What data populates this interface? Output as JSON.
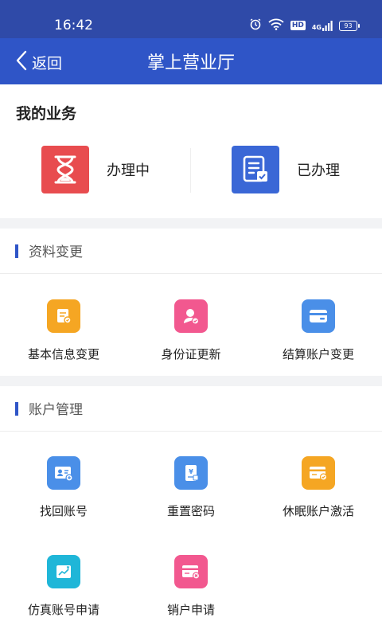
{
  "status_bar": {
    "time": "16:42",
    "hd": "HD",
    "signal": "4G",
    "battery": "93"
  },
  "nav": {
    "back_label": "返回",
    "title": "掌上营业厅"
  },
  "my_business": {
    "title": "我的业务",
    "items": [
      {
        "label": "办理中",
        "icon": "hourglass-icon",
        "color": "#e84c4f"
      },
      {
        "label": "已办理",
        "icon": "document-check-icon",
        "color": "#3a67d6"
      }
    ]
  },
  "sections": [
    {
      "title": "资料变更",
      "items": [
        {
          "label": "基本信息变更",
          "icon": "document-edit-icon",
          "color": "#f5a623"
        },
        {
          "label": "身份证更新",
          "icon": "person-check-icon",
          "color": "#f2588f"
        },
        {
          "label": "结算账户变更",
          "icon": "card-icon",
          "color": "#4a8fe8"
        }
      ]
    },
    {
      "title": "账户管理",
      "items": [
        {
          "label": "找回账号",
          "icon": "id-card-icon",
          "color": "#4a8fe8"
        },
        {
          "label": "重置密码",
          "icon": "yuan-doc-icon",
          "color": "#4a8fe8"
        },
        {
          "label": "休眠账户激活",
          "icon": "card-check-icon",
          "color": "#f5a623"
        },
        {
          "label": "仿真账号申请",
          "icon": "chart-doc-icon",
          "color": "#1fb6d8"
        },
        {
          "label": "销户申请",
          "icon": "card-close-icon",
          "color": "#f2588f"
        }
      ]
    }
  ]
}
